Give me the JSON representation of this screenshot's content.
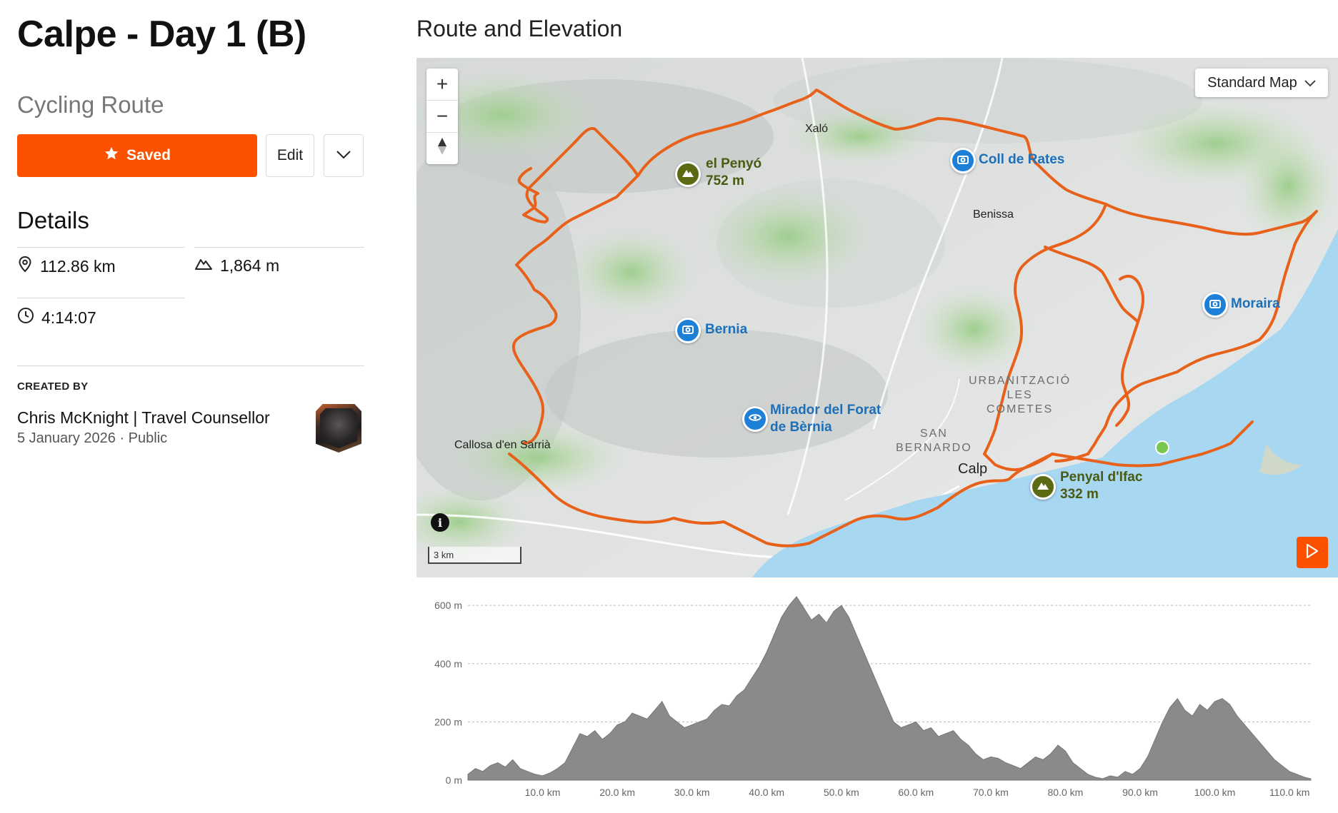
{
  "route": {
    "title": "Calpe - Day 1 (B)",
    "type": "Cycling Route"
  },
  "actions": {
    "saved_label": "Saved",
    "edit_label": "Edit"
  },
  "details": {
    "heading": "Details",
    "distance": "112.86 km",
    "elevation_gain": "1,864 m",
    "duration": "4:14:07"
  },
  "creator": {
    "label": "CREATED BY",
    "name": "Chris McKnight | Travel Counsellor",
    "date": "5 January 2026",
    "visibility": "Public"
  },
  "map_section": {
    "heading": "Route and Elevation",
    "map_type": "Standard Map",
    "scale_label": "3 km",
    "route_color": "#e8611a",
    "accent_color": "#fc5200",
    "places": {
      "xalo": "Xaló",
      "benissa": "Benissa",
      "callosa": "Callosa d'en Sarrià",
      "calp": "Calp"
    },
    "districts": {
      "urbanitzacio": "URBANITZACIÓ\nLES\nCOMETES",
      "san_bernardo": "SAN\nBERNARDO"
    },
    "pois": {
      "penyo_name": "el Penyó",
      "penyo_elev": "752 m",
      "coll": "Coll de Rates",
      "bernia": "Bernia",
      "mirador_line1": "Mirador del Forat",
      "mirador_line2": "de Bèrnia",
      "moraira": "Moraira",
      "ifac_name": "Penyal d'Ifac",
      "ifac_elev": "332 m"
    }
  },
  "chart_data": {
    "type": "area",
    "xlabel": "",
    "ylabel": "",
    "x_unit": "km",
    "y_unit": "m",
    "xlim": [
      0,
      112.86
    ],
    "ylim": [
      0,
      620
    ],
    "y_ticks": [
      "0 m",
      "200 m",
      "400 m",
      "600 m"
    ],
    "y_tick_values": [
      0,
      200,
      400,
      600
    ],
    "x_ticks": [
      "10.0 km",
      "20.0 km",
      "30.0 km",
      "40.0 km",
      "50.0 km",
      "60.0 km",
      "70.0 km",
      "80.0 km",
      "90.0 km",
      "100.0 km",
      "110.0 km"
    ],
    "x_tick_values": [
      10,
      20,
      30,
      40,
      50,
      60,
      70,
      80,
      90,
      100,
      110
    ],
    "grid": true,
    "series": [
      {
        "color": "#8a8a8a",
        "x": [
          0,
          1,
          2,
          3,
          4,
          5,
          6,
          7,
          8,
          9,
          10,
          11,
          12,
          13,
          14,
          15,
          16,
          17,
          18,
          19,
          20,
          21,
          22,
          23,
          24,
          25,
          26,
          27,
          28,
          29,
          30,
          31,
          32,
          33,
          34,
          35,
          36,
          37,
          38,
          39,
          40,
          41,
          42,
          43,
          44,
          45,
          46,
          47,
          48,
          49,
          50,
          51,
          52,
          53,
          54,
          55,
          56,
          57,
          58,
          59,
          60,
          61,
          62,
          63,
          64,
          65,
          66,
          67,
          68,
          69,
          70,
          71,
          72,
          73,
          74,
          75,
          76,
          77,
          78,
          79,
          80,
          81,
          82,
          83,
          84,
          85,
          86,
          87,
          88,
          89,
          90,
          91,
          92,
          93,
          94,
          95,
          96,
          97,
          98,
          99,
          100,
          101,
          102,
          103,
          104,
          105,
          106,
          107,
          108,
          109,
          110,
          111,
          112,
          112.86
        ],
        "y": [
          20,
          40,
          30,
          50,
          60,
          45,
          70,
          40,
          30,
          20,
          15,
          25,
          40,
          60,
          110,
          160,
          150,
          170,
          140,
          160,
          190,
          200,
          230,
          220,
          210,
          240,
          270,
          220,
          200,
          180,
          190,
          200,
          210,
          240,
          260,
          255,
          290,
          310,
          350,
          390,
          440,
          500,
          560,
          600,
          630,
          590,
          550,
          570,
          540,
          580,
          600,
          560,
          500,
          440,
          380,
          320,
          260,
          200,
          180,
          190,
          200,
          170,
          180,
          150,
          160,
          170,
          140,
          120,
          90,
          70,
          80,
          75,
          60,
          50,
          40,
          60,
          80,
          70,
          90,
          120,
          100,
          60,
          40,
          20,
          10,
          5,
          15,
          10,
          30,
          20,
          40,
          80,
          140,
          200,
          250,
          280,
          240,
          220,
          260,
          240,
          270,
          280,
          260,
          220,
          190,
          160,
          130,
          100,
          70,
          50,
          30,
          20,
          10,
          5
        ]
      }
    ]
  }
}
